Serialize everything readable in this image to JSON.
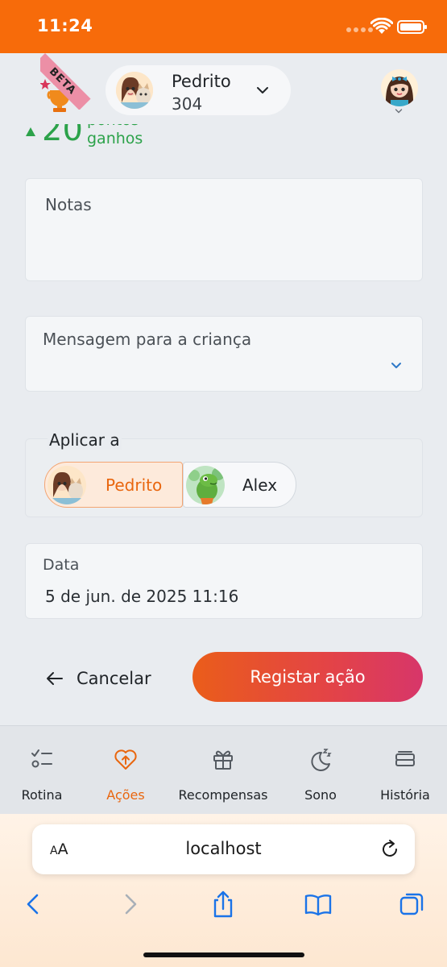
{
  "status_bar": {
    "time": "11:24"
  },
  "header": {
    "beta_label": "BETA",
    "child_name": "Pedrito",
    "child_points": "304"
  },
  "points_earned": {
    "value": "20",
    "label_line1": "pontos",
    "label_line2": "ganhos"
  },
  "form": {
    "notes_label": "Notas",
    "message_label": "Mensagem para a criança",
    "apply_label": "Aplicar a",
    "children": [
      {
        "name": "Pedrito",
        "selected": true
      },
      {
        "name": "Alex",
        "selected": false
      }
    ],
    "date_label": "Data",
    "date_value": "5 de jun. de 2025 11:16"
  },
  "actions": {
    "cancel_label": "Cancelar",
    "submit_label": "Registar ação"
  },
  "tabs": [
    {
      "label": "Rotina",
      "icon": "checklist-icon",
      "active": false
    },
    {
      "label": "Ações",
      "icon": "heart-arrow-icon",
      "active": true
    },
    {
      "label": "Recompensas",
      "icon": "gift-icon",
      "active": false
    },
    {
      "label": "Sono",
      "icon": "moon-sleep-icon",
      "active": false
    },
    {
      "label": "História",
      "icon": "history-icon",
      "active": false
    }
  ],
  "browser": {
    "text_size_label": "AA",
    "host": "localhost"
  },
  "colors": {
    "accent": "#f76b0a",
    "active_tab": "#e9660e",
    "points_green": "#2ca24a",
    "ios_blue": "#1a73e8"
  }
}
